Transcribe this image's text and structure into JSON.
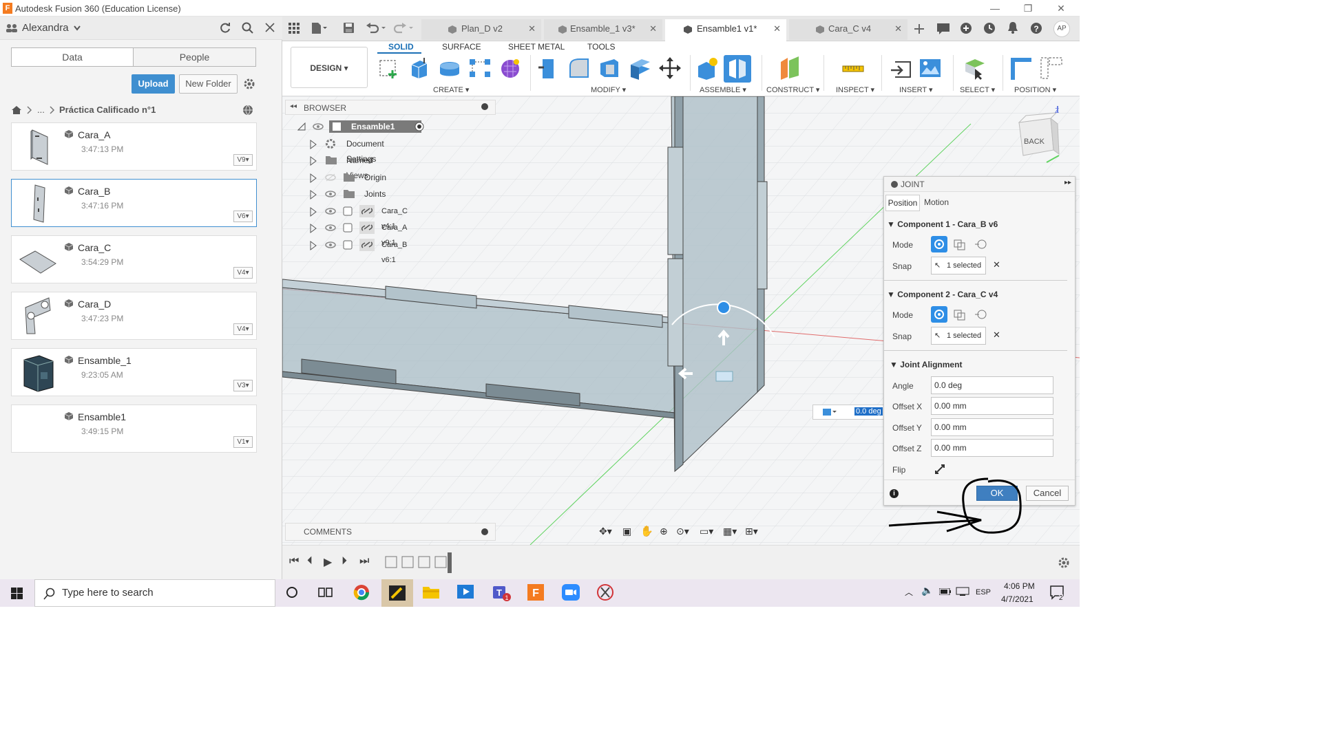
{
  "app": {
    "title": "Autodesk Fusion 360 (Education License)",
    "logo_letter": "F"
  },
  "window_controls": {
    "minimize": "—",
    "restore": "❐",
    "close": "✕"
  },
  "user": {
    "name": "Alexandra"
  },
  "data_panel": {
    "tabs": [
      "Data",
      "People"
    ],
    "upload_label": "Upload",
    "new_folder_label": "New Folder",
    "breadcrumb_ellipsis": "...",
    "breadcrumb_current": "Práctica Calificado n°1",
    "files": [
      {
        "name": "Cara_A",
        "time": "3:47:13 PM",
        "version": "V9"
      },
      {
        "name": "Cara_B",
        "time": "3:47:16 PM",
        "version": "V6"
      },
      {
        "name": "Cara_C",
        "time": "3:54:29 PM",
        "version": "V4"
      },
      {
        "name": "Cara_D",
        "time": "3:47:23 PM",
        "version": "V4"
      },
      {
        "name": "Ensamble_1",
        "time": "9:23:05 AM",
        "version": "V3"
      },
      {
        "name": "Ensamble1",
        "time": "3:49:15 PM",
        "version": "V1"
      }
    ]
  },
  "doc_tabs": [
    {
      "label": "Plan_D v2"
    },
    {
      "label": "Ensamble_1 v3*"
    },
    {
      "label": "Ensamble1 v1*"
    },
    {
      "label": "Cara_C v4"
    }
  ],
  "ribbon": {
    "workspace": "DESIGN",
    "tabs": [
      "SOLID",
      "SURFACE",
      "SHEET METAL",
      "TOOLS"
    ],
    "groups": [
      "CREATE",
      "MODIFY",
      "ASSEMBLE",
      "CONSTRUCT",
      "INSPECT",
      "INSERT",
      "SELECT",
      "POSITION"
    ]
  },
  "browser": {
    "title": "BROWSER",
    "root": "Ensamble1 v1",
    "items": [
      "Document Settings",
      "Named Views",
      "Origin",
      "Joints",
      "Cara_C v4:1",
      "Cara_A v9:1",
      "Cara_B v6:1"
    ]
  },
  "viewcube": {
    "face": "BACK",
    "axis": "Z"
  },
  "angle_input": {
    "value": "0.0 deg"
  },
  "joint": {
    "title": "JOINT",
    "tabs": [
      "Position",
      "Motion"
    ],
    "component1": {
      "header": "Component 1 - Cara_B v6",
      "mode_label": "Mode",
      "snap_label": "Snap",
      "snap_value": "1 selected"
    },
    "component2": {
      "header": "Component 2 - Cara_C v4",
      "mode_label": "Mode",
      "snap_label": "Snap",
      "snap_value": "1 selected"
    },
    "alignment": {
      "header": "Joint Alignment",
      "angle_label": "Angle",
      "angle": "0.0 deg",
      "offset_x_label": "Offset X",
      "offset_x": "0.00 mm",
      "offset_y_label": "Offset Y",
      "offset_y": "0.00 mm",
      "offset_z_label": "Offset Z",
      "offset_z": "0.00 mm",
      "flip_label": "Flip"
    },
    "ok_label": "OK",
    "cancel_label": "Cancel"
  },
  "comments": {
    "title": "COMMENTS"
  },
  "taskbar": {
    "search_placeholder": "Type here to search",
    "language": "ESP",
    "time": "4:06 PM",
    "date": "4/7/2021",
    "notifications": "2"
  },
  "user_initials": "AP",
  "colors": {
    "accent": "#3f8fd0",
    "ok_button": "#3f7fc0",
    "taskbar": "#ece6f0"
  }
}
